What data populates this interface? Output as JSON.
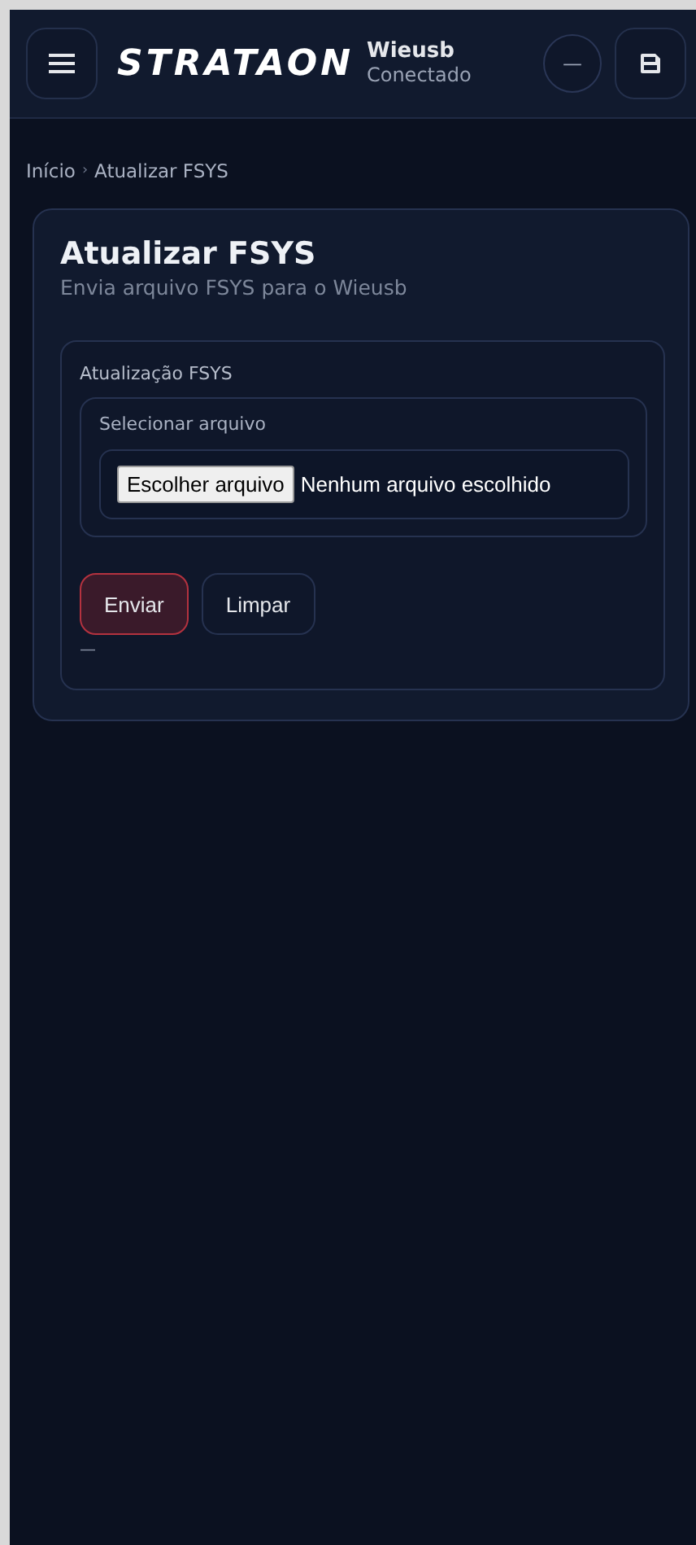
{
  "header": {
    "logo": "STRATAON",
    "device_name": "Wieusb",
    "device_status": "Conectado",
    "status_button": "—"
  },
  "breadcrumb": {
    "separator": "›",
    "items": [
      "Início",
      "Atualizar FSYS"
    ]
  },
  "page": {
    "title": "Atualizar FSYS",
    "subtitle": "Envia arquivo FSYS para o Wieusb"
  },
  "section": {
    "title": "Atualização FSYS",
    "file_group": {
      "label": "Selecionar arquivo",
      "choose_button": "Escolher arquivo",
      "file_status": "Nenhum arquivo escolhido"
    }
  },
  "buttons": [
    {
      "label": "Enviar",
      "kind": "primary"
    },
    {
      "label": "Limpar",
      "kind": "secondary"
    }
  ],
  "result": "—"
}
